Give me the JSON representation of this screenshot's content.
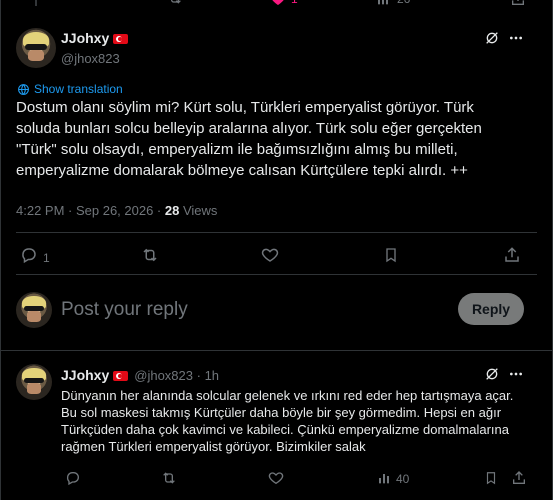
{
  "prev_tweet": {
    "like_count": "1",
    "view_count": "26"
  },
  "main_tweet": {
    "author_name": "JJohxy",
    "author_handle": "@jhox823",
    "show_translation": "Show translation",
    "text_lines": [
      "Dostum olanı söylim mi? Kürt solu, Türkleri emperyalist görüyor. Türk",
      "soluda bunları solcu belleyip aralarına alıyor. Türk solu eğer gerçekten",
      "\"Türk\" solu olsaydı, emperyalizm ile bağımsızlığını almış bu milleti,",
      "emperyalizme domalarak bölmeye calısan Kürtçülere tepki alırdı. ++"
    ],
    "timestamp": "4:22 PM · Sep 26, 2026 ·",
    "views_count": "28",
    "views_label": "Views",
    "reply_count": "1"
  },
  "compose": {
    "placeholder": "Post your reply",
    "button_label": "Reply"
  },
  "reply_tweet": {
    "author_name": "JJohxy",
    "author_handle": "@jhox823",
    "time": "1h",
    "text_lines": [
      "Dünyanın her alanında solcular gelenek ve ırkını red eder hep tartışmaya açar.",
      "Bu sol maskesi takmış Kürtçüler daha böyle bir şey görmedim. Hepsi en ağır",
      "Türkçüden daha çok kavimci ve kabileci. Çünkü emperyalizme domalmalarına",
      "rağmen Türkleri emperyalist görüyor. Bizimkiler salak"
    ],
    "views_count": "40"
  },
  "colors": {
    "accent": "#1d9bf0",
    "like": "#f91880",
    "flag": "#e30a17"
  },
  "icons": [
    "grok-icon",
    "more-icon",
    "reply-icon",
    "retweet-icon",
    "like-icon",
    "bookmark-icon",
    "share-icon",
    "views-icon",
    "translate-icon",
    "flag-icon"
  ]
}
